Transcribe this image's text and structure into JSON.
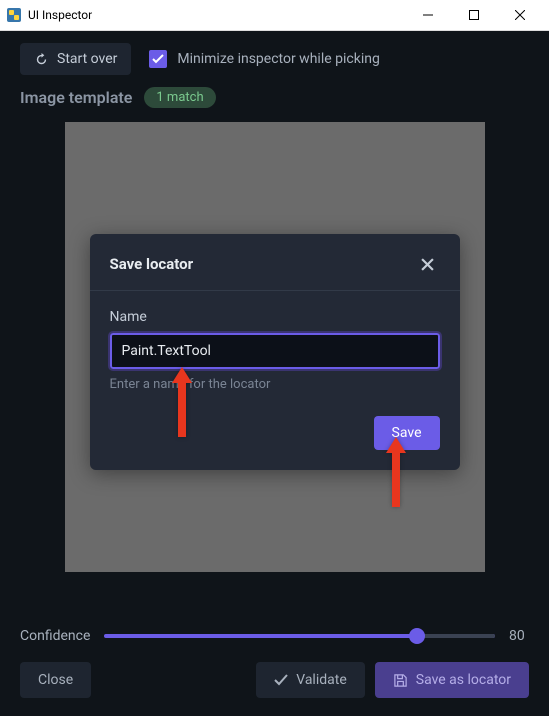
{
  "window": {
    "title": "UI Inspector"
  },
  "toolbar": {
    "start_over": "Start over",
    "minimize_checkbox_label": "Minimize inspector while picking"
  },
  "header": {
    "title": "Image template",
    "badge": "1 match"
  },
  "modal": {
    "title": "Save locator",
    "name_label": "Name",
    "name_value": "Paint.TextTool",
    "name_hint": "Enter a name for the locator",
    "save_button": "Save"
  },
  "slider": {
    "label": "Confidence",
    "value": "80",
    "position_pct": 80
  },
  "buttons": {
    "close": "Close",
    "validate": "Validate",
    "save_as_locator": "Save as locator"
  }
}
